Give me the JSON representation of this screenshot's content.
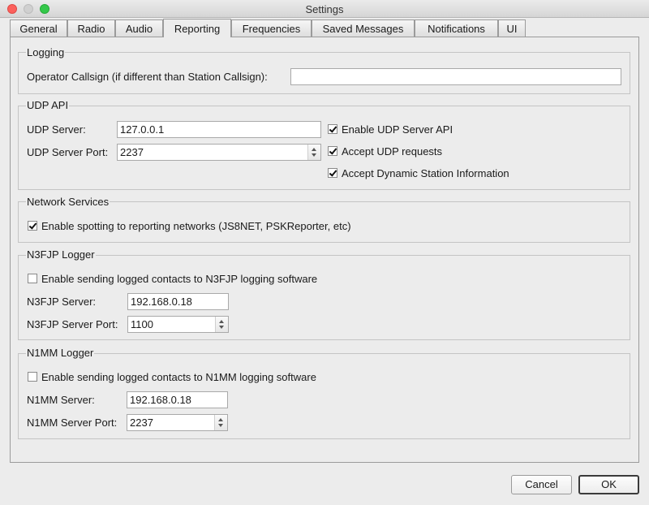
{
  "window": {
    "title": "Settings"
  },
  "tabs": [
    {
      "label": "General"
    },
    {
      "label": "Radio"
    },
    {
      "label": "Audio"
    },
    {
      "label": "Reporting"
    },
    {
      "label": "Frequencies"
    },
    {
      "label": "Saved Messages"
    },
    {
      "label": "Notifications"
    },
    {
      "label": "UI"
    }
  ],
  "active_tab": "Reporting",
  "logging": {
    "title": "Logging",
    "operator_label": "Operator Callsign (if different than Station Callsign):",
    "operator_value": ""
  },
  "udp": {
    "title": "UDP API",
    "server_label": "UDP Server:",
    "server_value": "127.0.0.1",
    "port_label": "UDP Server Port:",
    "port_value": "2237",
    "enable_label": "Enable UDP Server API",
    "enable_checked": true,
    "accept_label": "Accept UDP requests",
    "accept_checked": true,
    "dynamic_label": "Accept Dynamic Station Information",
    "dynamic_checked": true
  },
  "network": {
    "title": "Network Services",
    "spotting_label": "Enable spotting to reporting networks (JS8NET, PSKReporter, etc)",
    "spotting_checked": true
  },
  "n3fjp": {
    "title": "N3FJP Logger",
    "enable_label": "Enable sending logged contacts to N3FJP logging software",
    "enable_checked": false,
    "server_label": "N3FJP Server:",
    "server_value": "192.168.0.18",
    "port_label": "N3FJP Server Port:",
    "port_value": "1100"
  },
  "n1mm": {
    "title": "N1MM Logger",
    "enable_label": "Enable sending logged contacts to N1MM logging software",
    "enable_checked": false,
    "server_label": "N1MM Server:",
    "server_value": "192.168.0.18",
    "port_label": "N1MM Server Port:",
    "port_value": "2237"
  },
  "buttons": {
    "cancel": "Cancel",
    "ok": "OK"
  },
  "colors": {
    "close": "#fc605c",
    "minimize": "#d0d0d0",
    "maximize": "#34c84a",
    "panel": "#ececec"
  }
}
